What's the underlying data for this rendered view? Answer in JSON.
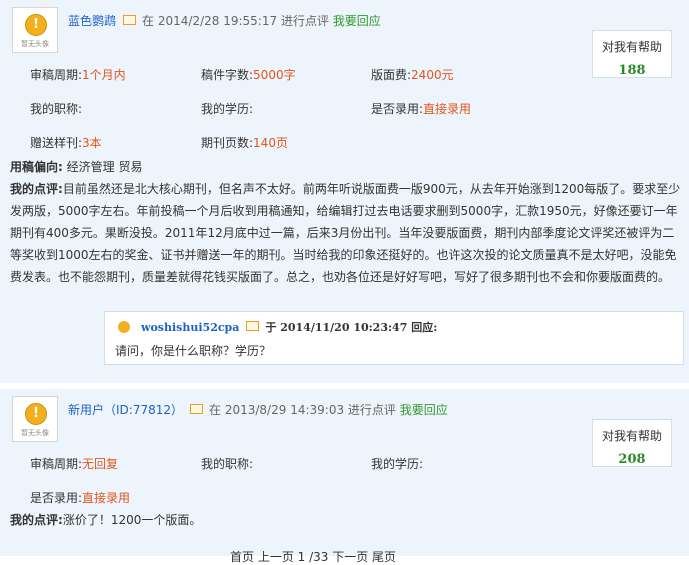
{
  "reviews": [
    {
      "avatar_icon": "coin-icon",
      "avatar_caption": "暂无头像",
      "username": "蓝色鹦鹉",
      "at": "在",
      "timestamp": "2014/2/28 19:55:17",
      "action": "进行点评",
      "reply_link": "我要回应",
      "help_label": "对我有帮助",
      "help_count": "188",
      "fields": {
        "review_period": {
          "label": "审稿周期:",
          "value": "1个月内"
        },
        "word_count": {
          "label": "稿件字数:",
          "value": "5000字"
        },
        "page_fee": {
          "label": "版面费:",
          "value": "2400元"
        },
        "title": {
          "label": "我的职称:",
          "value": ""
        },
        "education": {
          "label": "我的学历:",
          "value": ""
        },
        "accepted": {
          "label": "是否录用:",
          "value": "直接录用"
        },
        "sample_copies": {
          "label": "赠送样刊:",
          "value": "3本"
        },
        "pages": {
          "label": "期刊页数:",
          "value": "140页"
        }
      },
      "preference_label": "用稿偏向:",
      "preference_value": "经济管理 贸易",
      "comment_label": "我的点评:",
      "comment_text": "目前虽然还是北大核心期刊，但名声不太好。前两年听说版面费一版900元，从去年开始涨到1200每版了。要求至少发两版，5000字左右。年前投稿一个月后收到用稿通知，给编辑打过去电话要求删到5000字，汇款1950元，好像还要订一年期刊有400多元。果断没投。2011年12月底中过一篇，后来3月份出刊。当年没要版面费，期刊内部季度论文评奖还被评为二等奖收到1000左右的奖金、证书并赠送一年的期刊。当时给我的印象还挺好的。也许这次投的论文质量真不是太好吧，没能免费发表。也不能怨期刊，质量差就得花钱买版面了。总之，也劝各位还是好好写吧，写好了很多期刊也不会和你要版面费的。",
      "reply": {
        "user": "woshishui52cpa",
        "at": "于",
        "timestamp": "2014/11/20 10:23:47",
        "action": "回应:",
        "text": "请问，你是什么职称？学历？"
      }
    },
    {
      "avatar_icon": "coin-icon",
      "avatar_caption": "暂无头像",
      "username": "新用户（ID:77812）",
      "at": "在",
      "timestamp": "2013/8/29 14:39:03",
      "action": "进行点评",
      "reply_link": "我要回应",
      "help_label": "对我有帮助",
      "help_count": "208",
      "fields": {
        "review_period": {
          "label": "审稿周期:",
          "value": "无回复"
        },
        "title": {
          "label": "我的职称:",
          "value": ""
        },
        "education": {
          "label": "我的学历:",
          "value": ""
        },
        "accepted": {
          "label": "是否录用:",
          "value": "直接录用"
        }
      },
      "comment_label": "我的点评:",
      "comment_text": "涨价了！1200一个版面。"
    }
  ],
  "pager_text": "首页 上一页 1 /33 下一页 尾页"
}
